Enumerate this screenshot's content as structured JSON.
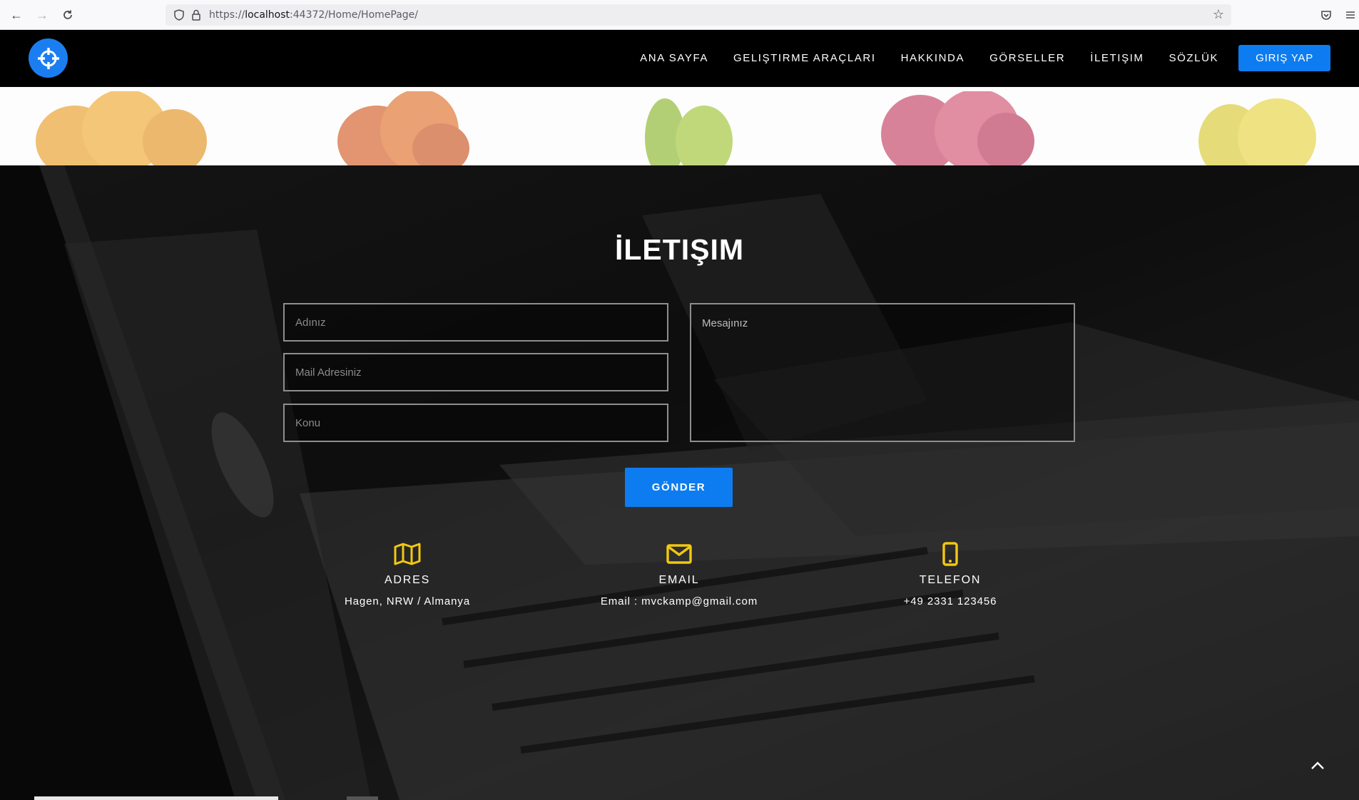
{
  "browser": {
    "url_prefix": "https://",
    "url_host": "localhost",
    "url_rest": ":44372/Home/HomePage/"
  },
  "nav": {
    "items": [
      "ANA SAYFA",
      "GELIŞTIRME ARAÇLARI",
      "HAKKINDA",
      "GÖRSELLER",
      "İLETIŞIM",
      "SÖZLÜK"
    ],
    "login": "GIRIŞ YAP"
  },
  "contact": {
    "title": "İLETIŞIM",
    "name_placeholder": "Adınız",
    "mail_placeholder": "Mail Adresiniz",
    "subject_placeholder": "Konu",
    "message_placeholder": "Mesajınız",
    "send": "GÖNDER"
  },
  "info": {
    "address": {
      "title": "ADRES",
      "value": "Hagen, NRW / Almanya",
      "icon": "map-icon"
    },
    "email": {
      "title": "EMAIL",
      "value": "Email : mvckamp@gmail.com",
      "icon": "envelope-icon"
    },
    "phone": {
      "title": "TELEFON",
      "value": "+49 2331 123456",
      "icon": "mobile-phone-icon"
    }
  },
  "colors": {
    "accent": "#0d7cf0",
    "icon": "#f2c811",
    "header": "#000000"
  }
}
